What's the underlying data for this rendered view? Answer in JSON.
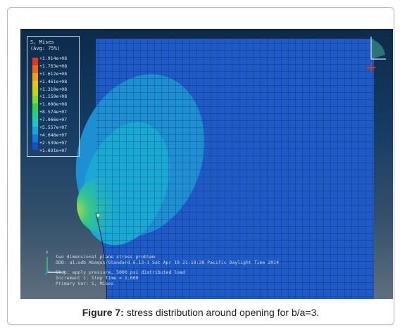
{
  "legend": {
    "title": "S, Mises",
    "subtitle": "(Avg: 75%)",
    "colors": [
      "#e8351f",
      "#f06a13",
      "#f4a012",
      "#e4c80e",
      "#b9d80d",
      "#7fdc1f",
      "#35d04a",
      "#1fd08c",
      "#1fc6c4",
      "#1aa2dc",
      "#1478dc",
      "#144fd0"
    ],
    "labels": [
      "+1.914e+08",
      "+1.763e+08",
      "+1.612e+08",
      "+1.461e+08",
      "+1.310e+08",
      "+1.159e+08",
      "+1.008e+08",
      "+8.574e+07",
      "+7.066e+07",
      "+5.557e+07",
      "+4.048e+07",
      "+2.539e+07",
      "+1.031e+07"
    ]
  },
  "info": {
    "line1": "two dimensional plane stress problem",
    "line2": "ODB: a1.odb    Abaqus/Standard 6.13-1    Sat Apr 19 21:19:38 Pacific Daylight Time 2014",
    "line3": "Step: apply pressure, 5000 psi distributed load",
    "line4": "Increment     1: Step Time =    1.000",
    "line5": "Primary Var: S, Mises"
  },
  "axes": {
    "y_label": "Y",
    "x_label": "X",
    "z_label": "Z"
  },
  "caption": {
    "label": "Figure 7:",
    "text": " stress distribution around opening for b/a=3."
  }
}
